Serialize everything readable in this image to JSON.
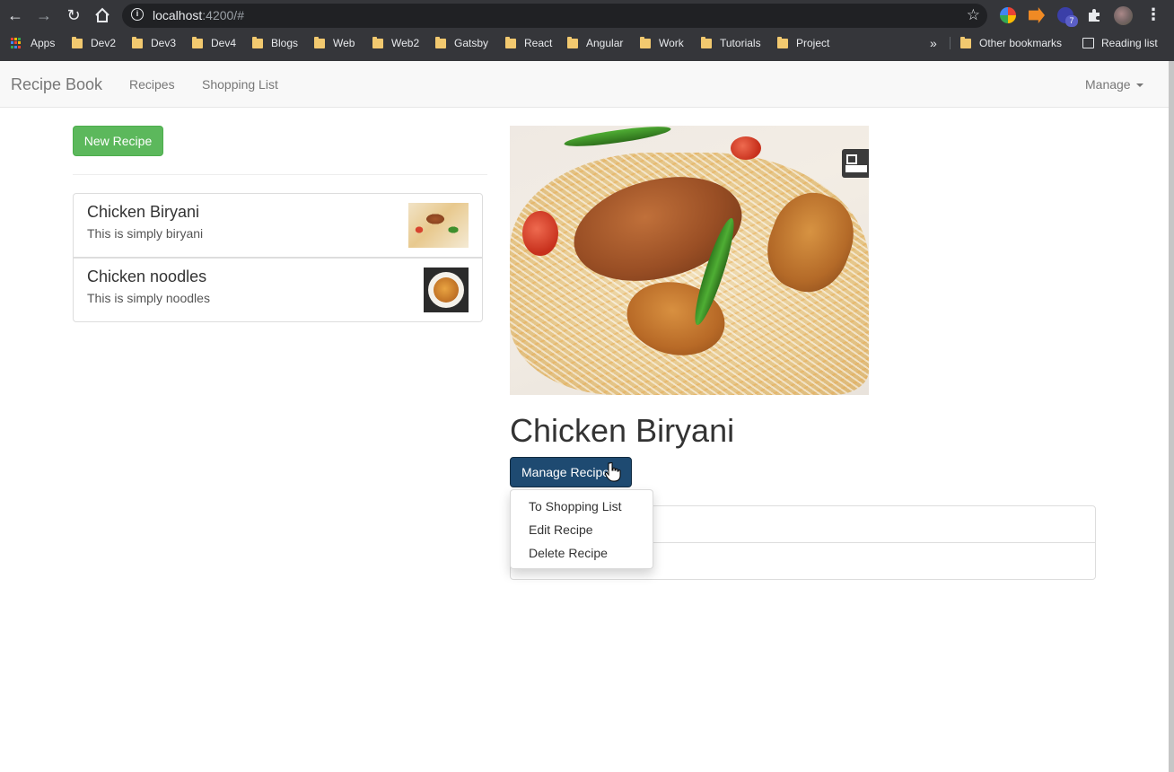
{
  "browser": {
    "url_host": "localhost",
    "url_rest": ":4200/#",
    "extension_badge": "7",
    "bookmarks": [
      "Apps",
      "Dev2",
      "Dev3",
      "Dev4",
      "Blogs",
      "Web",
      "Web2",
      "Gatsby",
      "React",
      "Angular",
      "Work",
      "Tutorials",
      "Project"
    ],
    "overflow": "»",
    "other_bookmarks": "Other bookmarks",
    "reading_list": "Reading list"
  },
  "navbar": {
    "brand": "Recipe Book",
    "links": [
      "Recipes",
      "Shopping List"
    ],
    "manage": "Manage"
  },
  "recipes": {
    "new_button": "New Recipe",
    "items": [
      {
        "name": "Chicken Biryani",
        "description": "This is simply biryani"
      },
      {
        "name": "Chicken noodles",
        "description": "This is simply noodles"
      }
    ]
  },
  "detail": {
    "title": "Chicken Biryani",
    "manage_button": "Manage Recipe",
    "menu": [
      "To Shopping List",
      "Edit Recipe",
      "Delete Recipe"
    ]
  }
}
